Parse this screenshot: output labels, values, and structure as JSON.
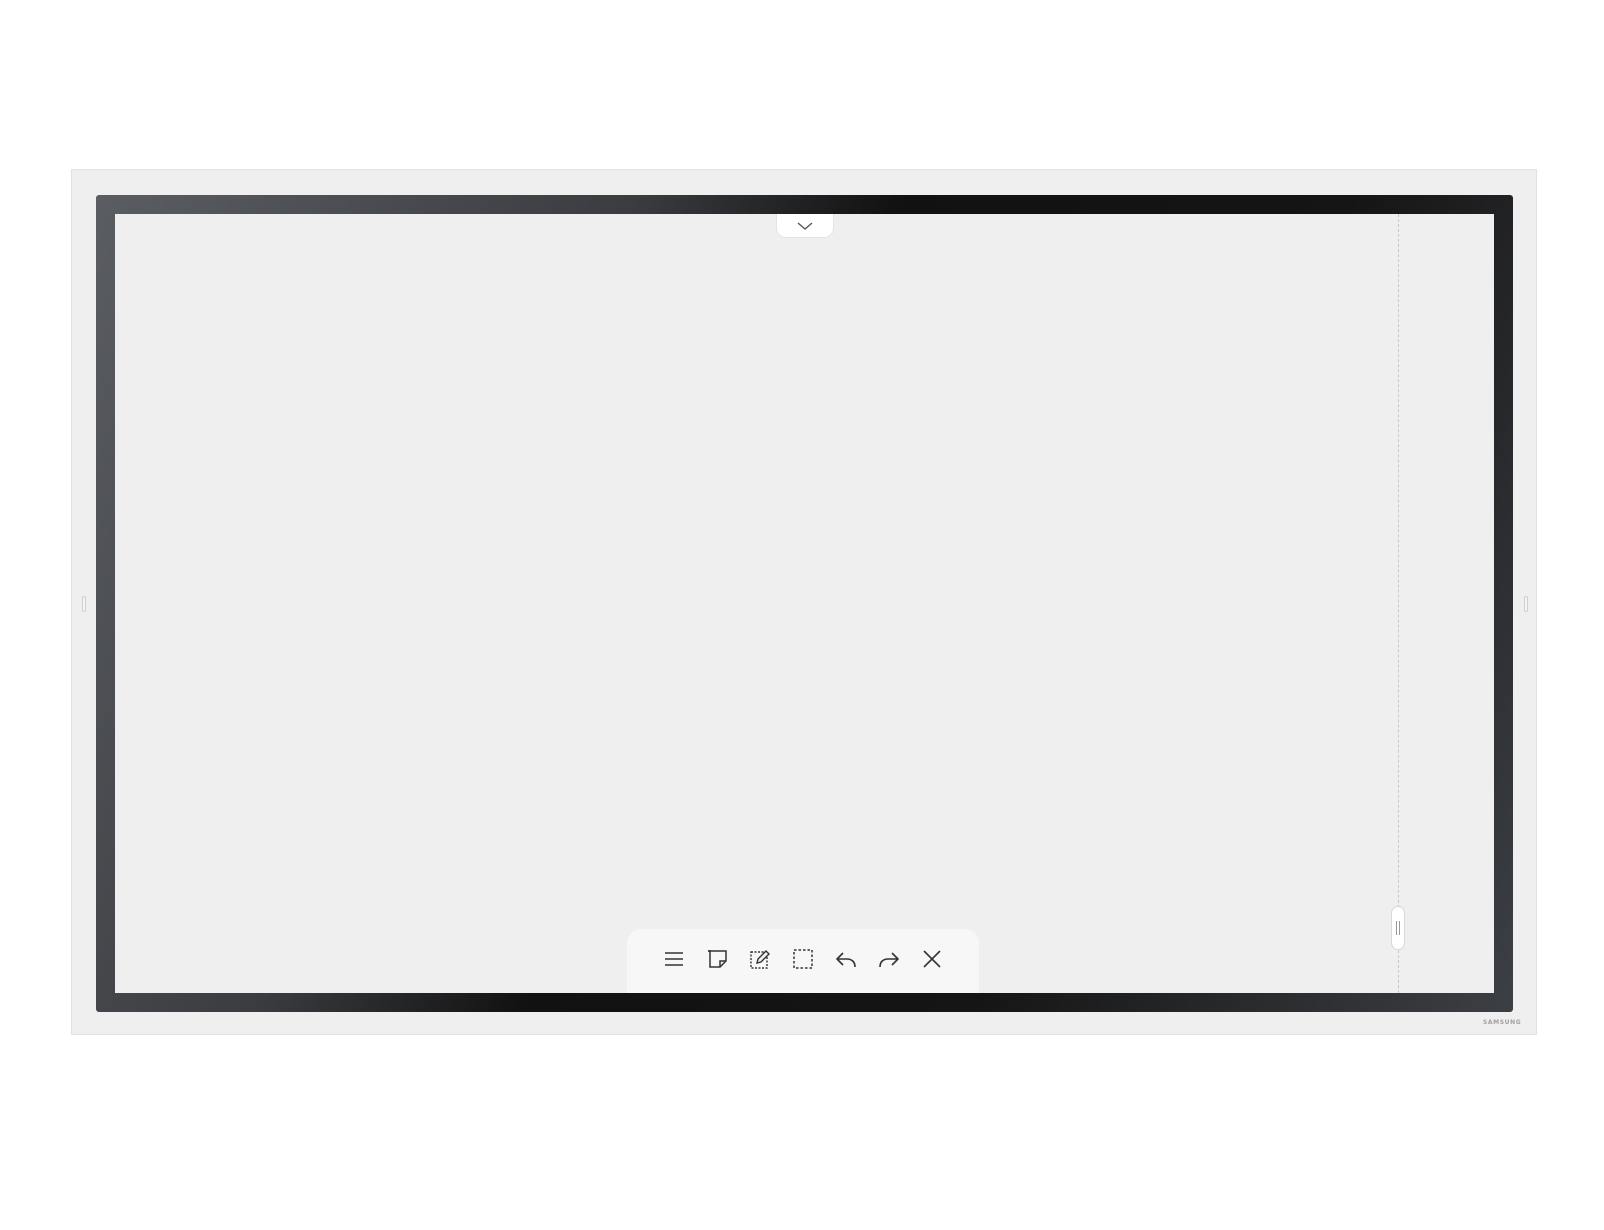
{
  "device": {
    "brand_text": "SAMSUNG",
    "frame_color": "#efefef",
    "bezel_color": "#111111",
    "screen_color": "#efefef"
  },
  "whiteboard": {
    "top_tab_icon": "chevron-down-icon",
    "toolbar": [
      {
        "name": "menu",
        "icon": "hamburger-menu-icon"
      },
      {
        "name": "sticky-note",
        "icon": "sticky-note-icon"
      },
      {
        "name": "edit-note",
        "icon": "edit-note-icon"
      },
      {
        "name": "select-area",
        "icon": "dashed-select-icon"
      },
      {
        "name": "undo",
        "icon": "undo-icon"
      },
      {
        "name": "redo",
        "icon": "redo-icon"
      },
      {
        "name": "close",
        "icon": "close-icon"
      }
    ]
  }
}
